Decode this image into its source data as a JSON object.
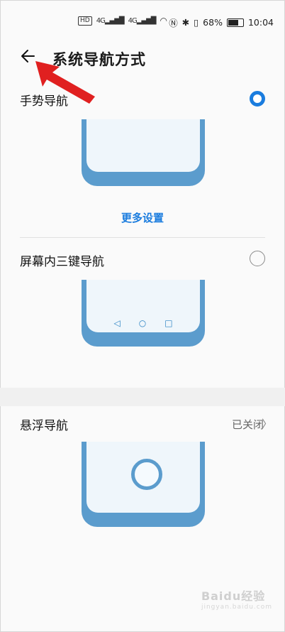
{
  "status_bar": {
    "hd_badge": "HD",
    "signal1": "4G",
    "signal2": "4G",
    "battery": "68%",
    "time": "10:04"
  },
  "header": {
    "back_icon": "arrow-left-icon",
    "title": "系统导航方式"
  },
  "options": [
    {
      "label": "手势导航",
      "selected": true
    },
    {
      "label": "屏幕内三键导航",
      "selected": false
    }
  ],
  "more_settings": "更多设置",
  "floating": {
    "label": "悬浮导航",
    "value": "已关闭"
  },
  "watermark": {
    "main": "Baidu经验",
    "sub": "jingyan.baidu.com"
  },
  "colors": {
    "accent": "#1a7cde",
    "phone": "#5b9ccd",
    "annotation_arrow": "#e02020"
  }
}
